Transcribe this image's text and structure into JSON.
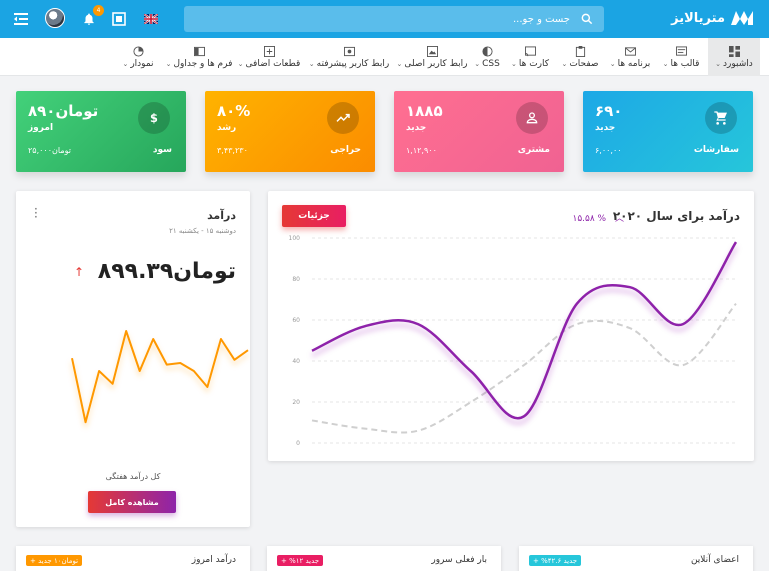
{
  "topbar": {
    "brand": "متریالایز",
    "search_placeholder": "جست و جو...",
    "notification_count": "4",
    "language_icon": "uk-flag-icon"
  },
  "menu": [
    {
      "label": "داشبورد",
      "icon": "dashboard-icon",
      "active": true
    },
    {
      "label": "قالب ها",
      "icon": "template-icon"
    },
    {
      "label": "برنامه ها",
      "icon": "mail-icon"
    },
    {
      "label": "صفحات",
      "icon": "clipboard-icon"
    },
    {
      "label": "کارت ها",
      "icon": "cast-icon"
    },
    {
      "label": "CSS",
      "icon": "contrast-icon"
    },
    {
      "label": "رابط کاربر اصلی",
      "icon": "photo-icon"
    },
    {
      "label": "رابط کاربر پیشرفته",
      "icon": "photo-filter-icon"
    },
    {
      "label": "قطعات اضافی",
      "icon": "add-box-icon"
    },
    {
      "label": "فرم ها و جداول",
      "icon": "form-icon"
    },
    {
      "label": "نمودار",
      "icon": "pie-chart-icon"
    }
  ],
  "stats": [
    {
      "label": "سفارشات",
      "value": "۶۹۰",
      "sub": "جدید",
      "small": "۶,۰۰,۰۰",
      "icon": "cart-icon",
      "color_from": "#1da8e6",
      "color_to": "#26c6da"
    },
    {
      "label": "مشتری",
      "value": "۱۸۸۵",
      "sub": "جدید",
      "small": "۱,۱۲,۹۰۰",
      "icon": "person-icon",
      "color_from": "#ff6f91",
      "color_to": "#f06292"
    },
    {
      "label": "حراجی",
      "value": "۸۰%",
      "sub": "رشد",
      "small": "۳,۴۳,۲۳۰",
      "icon": "trending-icon",
      "color_from": "#ffb300",
      "color_to": "#fb8c00"
    },
    {
      "label": "سود",
      "value": "تومان۸۹۰",
      "sub": "امروز",
      "small": "تومان۲۵,۰۰۰",
      "icon": "dollar-icon",
      "color_from": "#43d17a",
      "color_to": "#26a65b"
    }
  ],
  "revenue_chart": {
    "title": "درآمد برای سال ۲۰۲۰",
    "change": "۱۵.۵۸ %",
    "details_button": "جزئیات"
  },
  "revenue_card": {
    "title": "درآمد",
    "date": "دوشنبه ۱۵ - یکشنبه ۲۱",
    "amount": "تومان۸۹۹.۳۹",
    "caption": "کل درآمد هفتگی",
    "button": "مشاهده کامل"
  },
  "bottom_cards": [
    {
      "title": "اعضای آنلاین",
      "badge": "جدید ۴۲.۶% +",
      "color": "#26c6da"
    },
    {
      "title": "بار فعلی سرور",
      "badge": "جدید ۱۲% +",
      "color": "#e91e63"
    },
    {
      "title": "درآمد امروز",
      "badge": "تومان۱۰ جدید +",
      "color": "#ff9800"
    }
  ],
  "chart_data": [
    {
      "type": "line",
      "title": "درآمد برای سال ۲۰۲۰",
      "ylim": [
        0,
        100
      ],
      "yticks": [
        "0",
        "20",
        "40",
        "60",
        "80",
        "100"
      ],
      "grid": true,
      "series": [
        {
          "x": [
            0,
            1,
            2,
            3,
            4,
            5,
            6,
            7,
            8
          ],
          "values": [
            45,
            57,
            58,
            35,
            13,
            68,
            76,
            58,
            98
          ],
          "color": "#8e24aa"
        },
        {
          "x": [
            0,
            1,
            2,
            3,
            4,
            5,
            6,
            7,
            8
          ],
          "values": [
            11,
            7,
            6,
            20,
            38,
            58,
            56,
            38,
            68
          ],
          "color": "#cfcfcf"
        }
      ]
    },
    {
      "type": "line",
      "title": "درآمد",
      "series": [
        {
          "x": [
            0,
            1,
            2,
            3,
            4,
            5,
            6,
            7,
            8,
            9,
            10,
            11,
            12,
            13
          ],
          "values": [
            58,
            18,
            50,
            42,
            75,
            50,
            70,
            54,
            55,
            50,
            40,
            70,
            57,
            63
          ],
          "color": "#ff9800"
        }
      ]
    }
  ]
}
